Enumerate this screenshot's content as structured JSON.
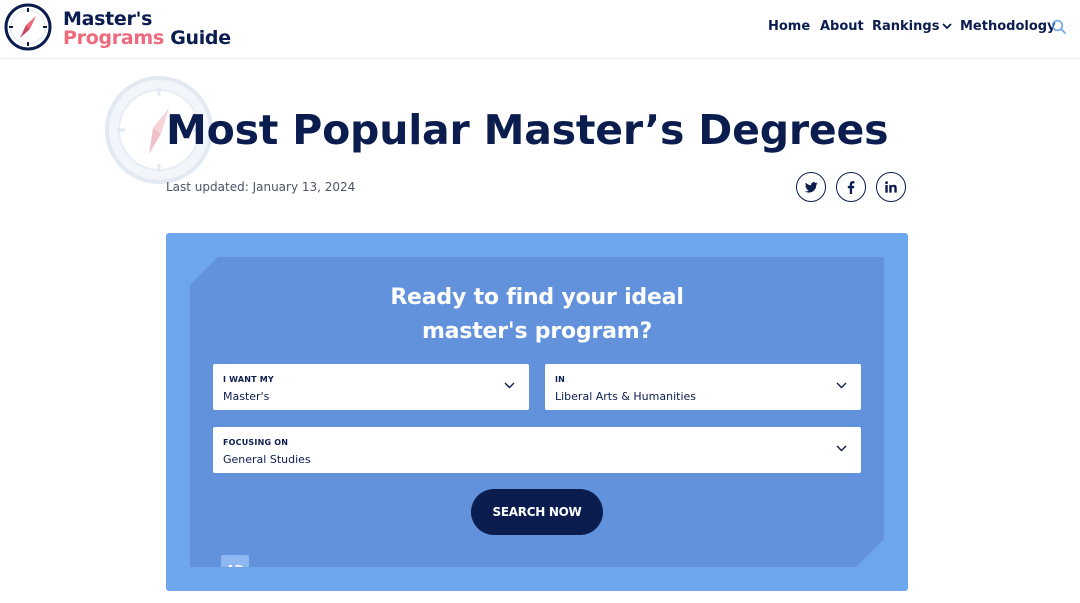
{
  "brand": {
    "line1": "Master's",
    "line2_part1": "Programs",
    "line2_part2": "Guide",
    "colors": {
      "navy": "#0b1d4f",
      "pink": "#ee6a7c",
      "accent_blue": "#6ea6ee"
    }
  },
  "nav": {
    "items": [
      {
        "label": "Home"
      },
      {
        "label": "About"
      },
      {
        "label": "Rankings"
      },
      {
        "label": "Methodology"
      }
    ],
    "search_icon": "search-icon"
  },
  "article": {
    "title": "Most Popular Master’s Degrees",
    "last_updated": "Last updated: January 13, 2024",
    "share": [
      "twitter-icon",
      "facebook-icon",
      "linkedin-icon"
    ]
  },
  "search_widget": {
    "heading": "Ready to find your ideal master's program?",
    "want": {
      "label": "I WANT MY",
      "value": "Master's"
    },
    "in": {
      "label": "IN",
      "value": "Liberal Arts & Humanities"
    },
    "focus": {
      "label": "FOCUSING ON",
      "value": "General Studies"
    },
    "button_label": "SEARCH NOW",
    "ad_label": "AD"
  }
}
